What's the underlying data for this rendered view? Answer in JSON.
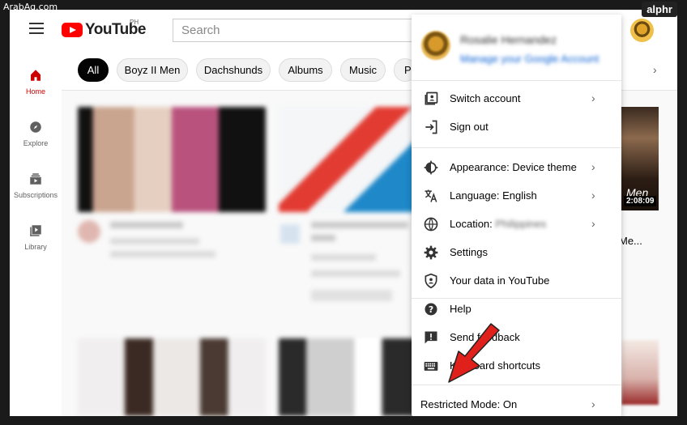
{
  "watermark": {
    "left": "ArabAq.com",
    "right": "alphr"
  },
  "topbar": {
    "logo_text": "YouTube",
    "logo_country": "PH",
    "search_placeholder": "Search"
  },
  "sidebar": {
    "items": [
      {
        "label": "Home",
        "icon": "home-icon"
      },
      {
        "label": "Explore",
        "icon": "compass-icon"
      },
      {
        "label": "Subscriptions",
        "icon": "subscriptions-icon"
      },
      {
        "label": "Library",
        "icon": "library-icon"
      }
    ]
  },
  "chips": [
    "All",
    "Boyz II Men",
    "Dachshunds",
    "Albums",
    "Music",
    "P"
  ],
  "peek": {
    "thumb_title": "Men",
    "duration": "2:08:09",
    "title_fragment": "Me..."
  },
  "menu": {
    "account_name": "Rosalie Hernandez",
    "account_link": "Manage your Google Account",
    "items": [
      {
        "label": "Switch account",
        "icon": "switch-account-icon",
        "chevron": true
      },
      {
        "label": "Sign out",
        "icon": "sign-out-icon",
        "chevron": false
      },
      {
        "label": "Appearance: Device theme",
        "icon": "appearance-icon",
        "chevron": true
      },
      {
        "label": "Language: English",
        "icon": "language-icon",
        "chevron": true
      },
      {
        "label": "Location:",
        "icon": "globe-icon",
        "chevron": true,
        "blurred_value": "Philippines"
      },
      {
        "label": "Settings",
        "icon": "settings-icon",
        "chevron": false
      },
      {
        "label": "Your data in YouTube",
        "icon": "shield-icon",
        "chevron": false
      },
      {
        "label": "Help",
        "icon": "help-icon",
        "chevron": false
      },
      {
        "label": "Send feedback",
        "icon": "feedback-icon",
        "chevron": false
      },
      {
        "label": "Keyboard shortcuts",
        "icon": "keyboard-icon",
        "chevron": false
      }
    ],
    "restricted_mode": "Restricted Mode: On"
  },
  "colors": {
    "youtube_red": "#ff0000",
    "accent_arrow": "#e0201b",
    "link_blue": "#065fd4"
  }
}
